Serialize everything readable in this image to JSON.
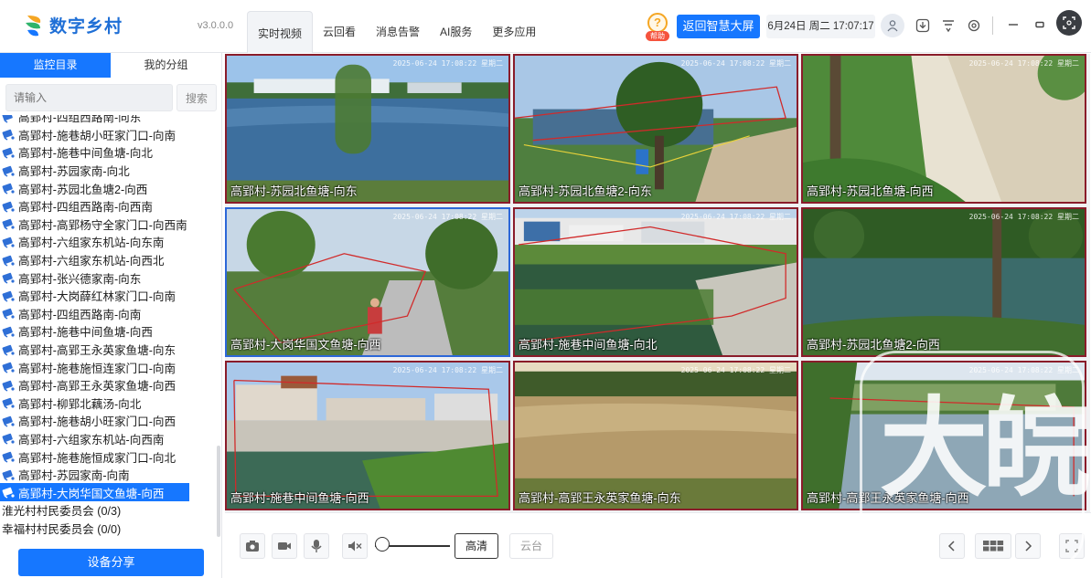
{
  "app": {
    "name": "数字乡村",
    "version": "v3.0.0.0"
  },
  "nav": {
    "items": [
      "实时视频",
      "云回看",
      "消息告警",
      "AI服务",
      "更多应用"
    ],
    "active_index": 0
  },
  "header": {
    "help_badge": "帮助",
    "dashboard_button": "返回智慧大屏",
    "datetime": "6月24日 周二 17:07:17"
  },
  "sidebar": {
    "tabs": [
      "监控目录",
      "我的分组"
    ],
    "active_tab": 0,
    "search_placeholder": "请输入",
    "search_button": "搜索",
    "partial_top_item": "高郢村-四组西路南-向东",
    "cameras": [
      "高郢村-施巷胡小旺家门口-向南",
      "高郢村-施巷中间鱼塘-向北",
      "高郢村-苏园家南-向北",
      "高郢村-苏园北鱼塘2-向西",
      "高郢村-四组西路南-向西南",
      "高郢村-高郢杨守全家门口-向西南",
      "高郢村-六组家东机站-向东南",
      "高郢村-六组家东机站-向西北",
      "高郢村-张兴德家南-向东",
      "高郢村-大岗薛红林家门口-向南",
      "高郢村-四组西路南-向南",
      "高郢村-施巷中间鱼塘-向西",
      "高郢村-高郢王永英家鱼塘-向东",
      "高郢村-施巷施恒连家门口-向南",
      "高郢村-高郢王永英家鱼塘-向西",
      "高郢村-柳郢北藕汤-向北",
      "高郢村-施巷胡小旺家门口-向西",
      "高郢村-六组家东机站-向西南",
      "高郢村-施巷施恒成家门口-向北",
      "高郢村-苏园家南-向南",
      "高郢村-大岗华国文鱼塘-向西"
    ],
    "selected_camera": "高郢村-大岗华国文鱼塘-向西",
    "groups": [
      "淮光村村民委员会 (0/3)",
      "幸福村村民委员会 (0/0)"
    ],
    "share_button": "设备分享"
  },
  "videos": [
    {
      "label": "高郢村-苏园北鱼塘-向东",
      "timestamp": "2025-06-24 17:08:22 星期二",
      "scene": "pond-greenhouse",
      "selected": false
    },
    {
      "label": "高郢村-苏园北鱼塘2-向东",
      "timestamp": "2025-06-24 17:08:22 星期二",
      "scene": "pond-tree",
      "selected": false
    },
    {
      "label": "高郢村-苏园北鱼塘-向西",
      "timestamp": "2025-06-24 17:08:22 星期二",
      "scene": "sandy-bank",
      "selected": false
    },
    {
      "label": "高郢村-大岗华国文鱼塘-向西",
      "timestamp": "2025-06-24 17:08:22 星期二",
      "scene": "road",
      "selected": true
    },
    {
      "label": "高郢村-施巷中间鱼塘-向北",
      "timestamp": "2025-06-24 17:08:22 星期二",
      "scene": "village-pond",
      "selected": false
    },
    {
      "label": "高郢村-苏园北鱼塘2-向西",
      "timestamp": "2025-06-24 17:08:22 星期二",
      "scene": "pond-trees",
      "selected": false
    },
    {
      "label": "高郢村-施巷中间鱼塘-向西",
      "timestamp": "2025-06-24 17:08:22 星期二",
      "scene": "village-houses",
      "selected": false
    },
    {
      "label": "高郢村-高郢王永英家鱼塘-向东",
      "timestamp": "2025-06-24 17:08:22 星期二",
      "scene": "sunset-pond",
      "selected": false
    },
    {
      "label": "高郢村-高郢王永英家鱼塘-向西",
      "timestamp": "2025-06-24 17:08:22 星期二",
      "scene": "reeds-pond",
      "selected": false
    }
  ],
  "toolbar": {
    "quality_button": "高清",
    "ptz_button": "云台",
    "volume_level": 0
  },
  "watermark": "大皖",
  "colors": {
    "accent": "#1677ff",
    "tile_border": "#8a1c2a",
    "tile_selected_border": "#2c67d8"
  }
}
